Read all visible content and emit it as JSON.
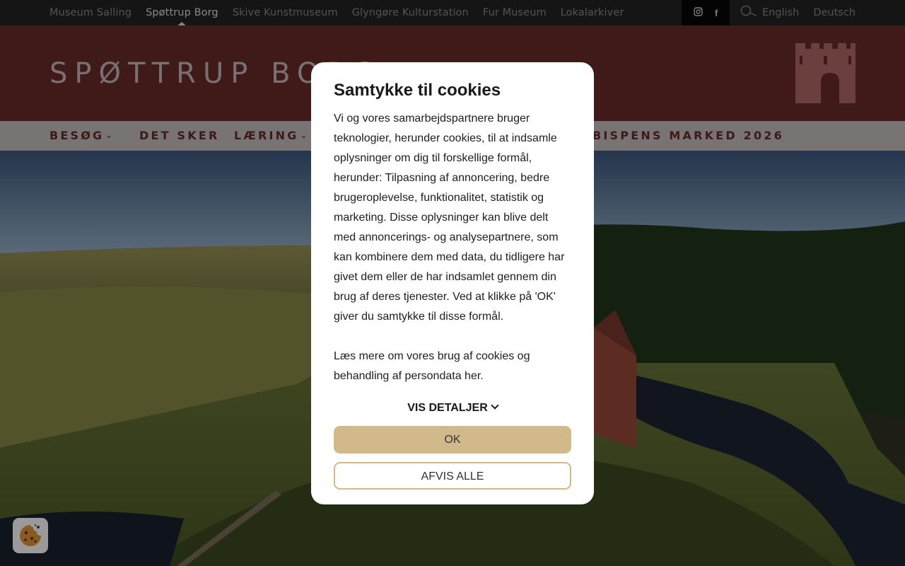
{
  "topbar": {
    "sites": [
      {
        "label": "Museum Salling",
        "active": false
      },
      {
        "label": "Spøttrup Borg",
        "active": true
      },
      {
        "label": "Skive Kunstmuseum",
        "active": false
      },
      {
        "label": "Glyngøre Kulturstation",
        "active": false
      },
      {
        "label": "Fur Museum",
        "active": false
      },
      {
        "label": "Lokalarkiver",
        "active": false
      }
    ],
    "social": {
      "instagram_icon": "instagram-icon",
      "facebook_icon": "facebook-icon",
      "facebook_glyph": "f"
    },
    "search_icon": "search-icon",
    "languages": [
      "English",
      "Deutsch"
    ]
  },
  "header": {
    "brand": "SPØTTRUP BORG",
    "logo_icon": "castle-logo-icon",
    "color": "#6b2a2a"
  },
  "nav": {
    "items": [
      {
        "label": "BESØG",
        "has_dropdown": true
      },
      {
        "label": "DET SKER",
        "has_dropdown": false
      },
      {
        "label": "LÆRING",
        "has_dropdown": true
      },
      {
        "label": "BISPENS MARKED 2026",
        "has_dropdown": false
      }
    ],
    "chevron": "⌄"
  },
  "cookie_dialog": {
    "title": "Samtykke til cookies",
    "body": "Vi og vores samarbejdspartnere bruger teknologier, herunder cookies, til at indsamle oplysninger om dig til forskellige formål, herunder: Tilpasning af annoncering, bedre brugeroplevelse, funktionalitet, statistik og marketing. Disse oplysninger kan blive delt med annoncerings- og analysepartnere, som kan kombinere dem med data, du tidligere har givet dem eller de har indsamlet gennem din brug af deres tjenester. Ved at klikke på 'OK' giver du samtykke til disse formål.",
    "read_more": "Læs mere om vores brug af cookies og behandling af persondata her.",
    "details_label": "VIS DETALJER",
    "ok_label": "OK",
    "reject_label": "AFVIS ALLE",
    "accent": "#d2b98a"
  },
  "cookie_badge": {
    "icon": "cookie-icon"
  }
}
